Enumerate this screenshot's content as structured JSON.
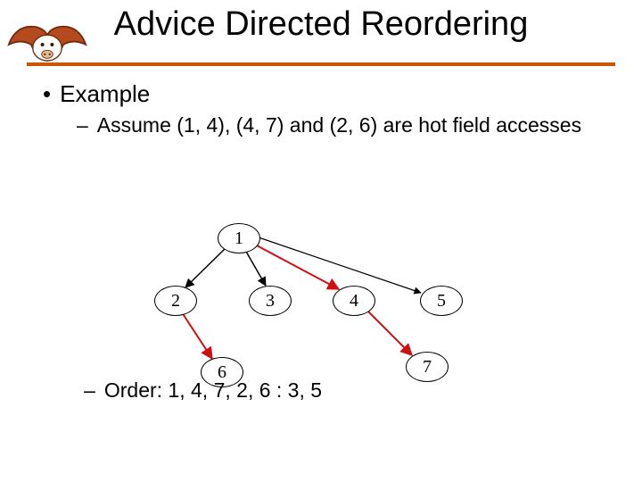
{
  "title": "Advice Directed Reordering",
  "bullets": {
    "l1": "Example",
    "l2a": "Assume (1, 4), (4, 7) and (2, 6) are hot field accesses",
    "l2b_prefix": "Order: ",
    "l2b_rest": "1, 4, 7, 2, 6 : 3, 5"
  },
  "nodes": {
    "n1": "1",
    "n2": "2",
    "n3": "3",
    "n4": "4",
    "n5": "5",
    "n6": "6",
    "n7": "7"
  },
  "colors": {
    "rule": "#cc5500",
    "logo_fill": "#b54a1e",
    "logo_stroke": "#6e2a0b",
    "hot_edge": "#d01010"
  },
  "chart_data": {
    "type": "tree",
    "title": "Advice Directed Reordering",
    "nodes": [
      1,
      2,
      3,
      4,
      5,
      6,
      7
    ],
    "edges": [
      {
        "from": 1,
        "to": 2,
        "hot": false
      },
      {
        "from": 1,
        "to": 3,
        "hot": false
      },
      {
        "from": 1,
        "to": 4,
        "hot": true
      },
      {
        "from": 1,
        "to": 5,
        "hot": false
      },
      {
        "from": 2,
        "to": 6,
        "hot": true
      },
      {
        "from": 4,
        "to": 7,
        "hot": true
      }
    ],
    "hot_pairs": [
      "(1,4)",
      "(4,7)",
      "(2,6)"
    ],
    "reorder_output": "1, 4, 7, 2, 6 : 3, 5"
  }
}
